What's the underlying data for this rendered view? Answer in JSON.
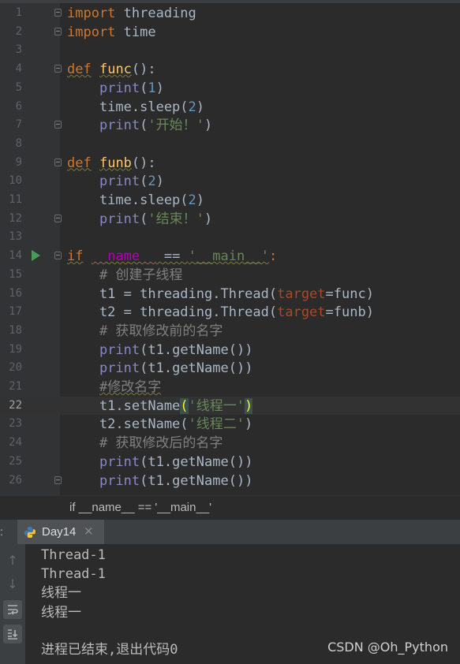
{
  "editor": {
    "lines": [
      {
        "num": "1",
        "segs": [
          {
            "t": "import",
            "c": "kw"
          },
          {
            "t": " threading",
            "c": ""
          }
        ]
      },
      {
        "num": "2",
        "segs": [
          {
            "t": "import",
            "c": "kw"
          },
          {
            "t": " time",
            "c": ""
          }
        ]
      },
      {
        "num": "3",
        "segs": []
      },
      {
        "num": "4",
        "segs": [
          {
            "t": "def",
            "c": "kw wavy"
          },
          {
            "t": " ",
            "c": ""
          },
          {
            "t": "func",
            "c": "fn wavy"
          },
          {
            "t": "():",
            "c": ""
          }
        ]
      },
      {
        "num": "5",
        "segs": [
          {
            "t": "    ",
            "c": ""
          },
          {
            "t": "print",
            "c": "bi"
          },
          {
            "t": "(",
            "c": ""
          },
          {
            "t": "1",
            "c": "num"
          },
          {
            "t": ")",
            "c": ""
          }
        ]
      },
      {
        "num": "6",
        "segs": [
          {
            "t": "    time.sleep(",
            "c": ""
          },
          {
            "t": "2",
            "c": "num"
          },
          {
            "t": ")",
            "c": ""
          }
        ]
      },
      {
        "num": "7",
        "segs": [
          {
            "t": "    ",
            "c": ""
          },
          {
            "t": "print",
            "c": "bi"
          },
          {
            "t": "(",
            "c": ""
          },
          {
            "t": "'开始！'",
            "c": "str"
          },
          {
            "t": ")",
            "c": ""
          }
        ]
      },
      {
        "num": "8",
        "segs": []
      },
      {
        "num": "9",
        "segs": [
          {
            "t": "def",
            "c": "kw wavy"
          },
          {
            "t": " ",
            "c": ""
          },
          {
            "t": "funb",
            "c": "fn wavy"
          },
          {
            "t": "():",
            "c": ""
          }
        ]
      },
      {
        "num": "10",
        "segs": [
          {
            "t": "    ",
            "c": ""
          },
          {
            "t": "print",
            "c": "bi"
          },
          {
            "t": "(",
            "c": ""
          },
          {
            "t": "2",
            "c": "num"
          },
          {
            "t": ")",
            "c": ""
          }
        ]
      },
      {
        "num": "11",
        "segs": [
          {
            "t": "    time.sleep(",
            "c": ""
          },
          {
            "t": "2",
            "c": "num"
          },
          {
            "t": ")",
            "c": ""
          }
        ]
      },
      {
        "num": "12",
        "segs": [
          {
            "t": "    ",
            "c": ""
          },
          {
            "t": "print",
            "c": "bi"
          },
          {
            "t": "(",
            "c": ""
          },
          {
            "t": "'结束！'",
            "c": "str"
          },
          {
            "t": ")",
            "c": ""
          }
        ]
      },
      {
        "num": "13",
        "segs": []
      },
      {
        "num": "14",
        "segs": [
          {
            "t": "if",
            "c": "kw wavy"
          },
          {
            "t": " ",
            "c": ""
          },
          {
            "t": "__name__",
            "c": "dun wavy"
          },
          {
            "t": " == ",
            "c": "wavy"
          },
          {
            "t": "'__main__'",
            "c": "str wavy"
          },
          {
            "t": ":",
            "c": "kw"
          }
        ]
      },
      {
        "num": "15",
        "segs": [
          {
            "t": "    # 创建子线程",
            "c": "cmt"
          }
        ]
      },
      {
        "num": "16",
        "segs": [
          {
            "t": "    t1 = threading.Thread(",
            "c": ""
          },
          {
            "t": "target",
            "c": "prm"
          },
          {
            "t": "=func)",
            "c": ""
          }
        ]
      },
      {
        "num": "17",
        "segs": [
          {
            "t": "    t2 = threading.Thread(",
            "c": ""
          },
          {
            "t": "target",
            "c": "prm"
          },
          {
            "t": "=funb)",
            "c": ""
          }
        ]
      },
      {
        "num": "18",
        "segs": [
          {
            "t": "    # 获取修改前的名字",
            "c": "cmt"
          }
        ]
      },
      {
        "num": "19",
        "segs": [
          {
            "t": "    ",
            "c": ""
          },
          {
            "t": "print",
            "c": "bi"
          },
          {
            "t": "(t1.getName())",
            "c": ""
          }
        ]
      },
      {
        "num": "20",
        "segs": [
          {
            "t": "    ",
            "c": ""
          },
          {
            "t": "print",
            "c": "bi"
          },
          {
            "t": "(t1.getName())",
            "c": ""
          }
        ]
      },
      {
        "num": "21",
        "segs": [
          {
            "t": "    ",
            "c": ""
          },
          {
            "t": "#修改名字",
            "c": "cmt wavy"
          }
        ]
      },
      {
        "num": "22",
        "segs": [
          {
            "t": "    t1.setName",
            "c": ""
          },
          {
            "t": "(",
            "c": "hl"
          },
          {
            "t": "'线程一'",
            "c": "str"
          },
          {
            "t": ")",
            "c": "hl"
          }
        ]
      },
      {
        "num": "23",
        "segs": [
          {
            "t": "    t2.setName(",
            "c": ""
          },
          {
            "t": "'线程二'",
            "c": "str"
          },
          {
            "t": ")",
            "c": ""
          }
        ]
      },
      {
        "num": "24",
        "segs": [
          {
            "t": "    # 获取修改后的名字",
            "c": "cmt"
          }
        ]
      },
      {
        "num": "25",
        "segs": [
          {
            "t": "    ",
            "c": ""
          },
          {
            "t": "print",
            "c": "bi"
          },
          {
            "t": "(t1.getName())",
            "c": ""
          }
        ]
      },
      {
        "num": "26",
        "segs": [
          {
            "t": "    ",
            "c": ""
          },
          {
            "t": "print",
            "c": "bi"
          },
          {
            "t": "(t1.getName())",
            "c": ""
          }
        ]
      }
    ]
  },
  "breadcrumb": {
    "text": "if __name__ == '__main__'"
  },
  "run_panel": {
    "colon": ":",
    "tab_label": "Day14",
    "tab_close": "×",
    "output": [
      "Thread-1",
      "Thread-1",
      "线程一",
      "线程一"
    ],
    "exit_message": "进程已结束,退出代码0"
  },
  "watermark": "CSDN @Oh_Python",
  "icons": {
    "fold": "fold-marker-icon",
    "run": "run-gutter-icon",
    "python": "python-icon",
    "up": "arrow-up-icon",
    "down": "arrow-down-icon",
    "wrap": "soft-wrap-icon",
    "scroll": "scroll-to-end-icon"
  },
  "colors": {
    "background": "#2b2b2b",
    "keyword": "#cc7832",
    "string": "#6a8759",
    "number": "#6897bb",
    "builtin": "#8888c6",
    "comment": "#808080"
  }
}
